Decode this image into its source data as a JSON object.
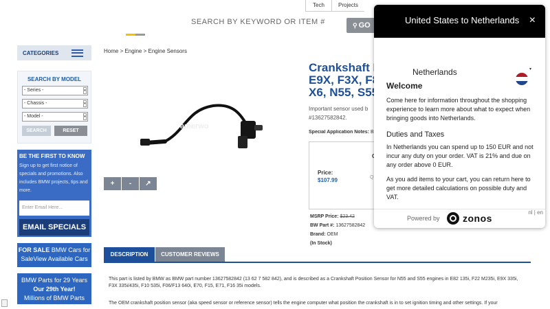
{
  "topnav": {
    "items": [
      "Tech",
      "Projects"
    ]
  },
  "colors": {
    "accent_blue": "#1d4f9a",
    "stripe_yellow": "#f2c200",
    "stripe_gray": "#999999",
    "flag_red": "#ae1c28",
    "flag_blue": "#21468b"
  },
  "search": {
    "placeholder": "SEARCH BY KEYWORD OR ITEM #",
    "go_label": "GO",
    "go_icon": "search-icon"
  },
  "sidebar": {
    "categories_label": "CATEGORIES",
    "search_by_model": "SEARCH BY MODEL",
    "series": "- Series -",
    "chassis": "- Chassis -",
    "model": "- Model -",
    "search_btn": "SEARCH",
    "reset_btn": "RESET",
    "promo_title": "BE THE FIRST TO KNOW",
    "promo_text": "Sign up to get first notice of specials and promotions. Also includes BMW projects, tips and more.",
    "email_placeholder": "Enter Email Here...",
    "email_btn": "EMAIL SPECIALS",
    "sale_line1": "FOR SALE",
    "sale_line1_rest": " BMW Cars for",
    "sale_line2": "SaleView Available Cars",
    "years_line1": "BMW Parts for 29 Years",
    "years_line2": "Our 29th Year!",
    "years_line3": "Millions of BMW Parts"
  },
  "breadcrumb": "Home > Engine > Engine Sensors",
  "product": {
    "title_line1": "Crankshaft P",
    "title_line2": "E9X, F3X, F8",
    "title_line3": "X6, N55, S55",
    "desc_line1": "Important sensor used b",
    "desc_line2": "#13627582842.",
    "spec_label": "Special Application Notes:",
    "spec_value": "BM",
    "box_partial": "O",
    "price_label": "Price:",
    "price": "$107.99",
    "qty_partial": "Q",
    "msrp_label": "MSRP Price:",
    "msrp": "$23.42",
    "part_label": "BW Part #:",
    "part": "13627582842",
    "brand_label": "Brand:",
    "brand": "OEM",
    "stock": "(In Stock)",
    "watermark": "amerwo"
  },
  "tools": [
    "+",
    "-",
    "↗"
  ],
  "tabs": [
    "DESCRIPTION",
    "CUSTOMER REVIEWS"
  ],
  "description": {
    "p1": "This part is listed by BMW as BMW part number 13627582842 (13 62 7 582 842), and is described as a Crankshaft Position Sensor for N55 and S55 engines in E82 135i, F22 M235i, E9X 335i, F3X 335i/435i, F10 535i, F06/F13 640i, E70, F15, E71, F16 35i models.",
    "p2": "The OEM crankshaft position sensor (aka speed sensor or reference sensor) tells the engine computer what position the crankshaft is in to set ignition timing and other settings. If your"
  },
  "modal": {
    "header": "United States to Netherlands",
    "close": "×",
    "country": "Netherlands",
    "welcome": "Welcome",
    "p1": "Come here for information throughout the shopping experience to learn more about what to expect when bringing goods into Netherlands.",
    "duties_title": "Duties and Taxes",
    "p2": "In Netherlands you can spend up to 150 EUR and not incur any duty on your order. VAT is 21% and due on any order above 0 EUR.",
    "p3": "As you add items to your cart, you can return here to get more detailed calculations on possible duty and VAT.",
    "powered_by": "Powered by",
    "brand": "zonos",
    "lang": "nl | en"
  }
}
